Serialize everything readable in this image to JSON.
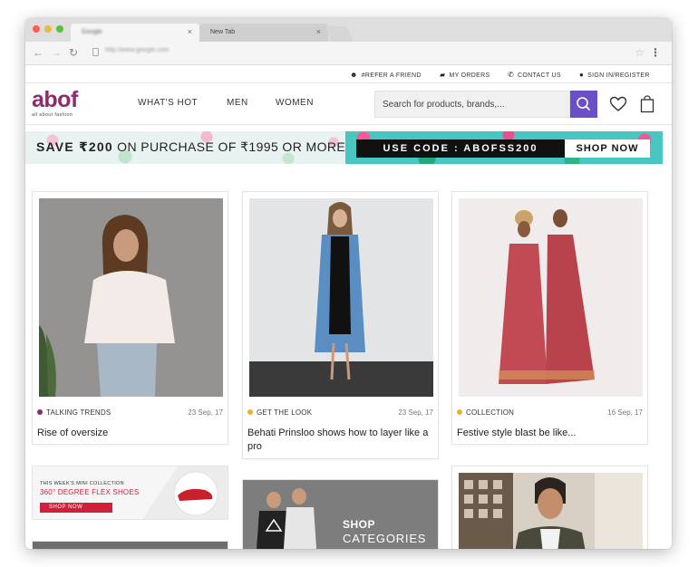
{
  "browser": {
    "tabs": [
      {
        "label": "Google",
        "active": true
      },
      {
        "label": "New Tab",
        "active": false
      }
    ],
    "url": "http://www.google.com"
  },
  "utility_links": [
    {
      "label": "#REFER A FRIEND",
      "icon": "refer-icon"
    },
    {
      "label": "MY ORDERS",
      "icon": "truck-icon"
    },
    {
      "label": "CONTACT US",
      "icon": "phone-icon"
    },
    {
      "label": "SIGN IN/REGISTER",
      "icon": "user-icon"
    }
  ],
  "logo": {
    "text": "abof",
    "tagline": "all about fashion"
  },
  "nav": {
    "items": [
      "WHAT'S HOT",
      "MEN",
      "WOMEN"
    ]
  },
  "search": {
    "placeholder": "Search for products, brands,..."
  },
  "banner": {
    "save": "SAVE ₹200",
    "rest": "ON PURCHASE OF ₹1995 OR MORE",
    "code": "USE CODE : ABOFSS200",
    "cta": "SHOP NOW"
  },
  "cards": [
    {
      "category": "TALKING TRENDS",
      "date": "23 Sep, 17",
      "title": "Rise of oversize",
      "color": "#8e2b6b"
    },
    {
      "category": "GET THE LOOK",
      "date": "23 Sep, 17",
      "title": "Behati Prinsloo shows how to layer like a pro",
      "color": "#e5b42a"
    },
    {
      "category": "COLLECTION",
      "date": "16 Sep, 17",
      "title": "Festive style blast be like...",
      "color": "#e5b42a"
    }
  ],
  "promo": {
    "small": "THIS WEEK'S MINI COLLECTION",
    "big": "360° DEGREE FLEX SHOES",
    "cta": "SHOP NOW"
  },
  "categories_tile": {
    "line1": "SHOP",
    "line2": "CATEGORIES"
  },
  "colors": {
    "brand": "#8e2b6b",
    "accent": "#6a4fc6",
    "promo_red": "#d0213b"
  }
}
